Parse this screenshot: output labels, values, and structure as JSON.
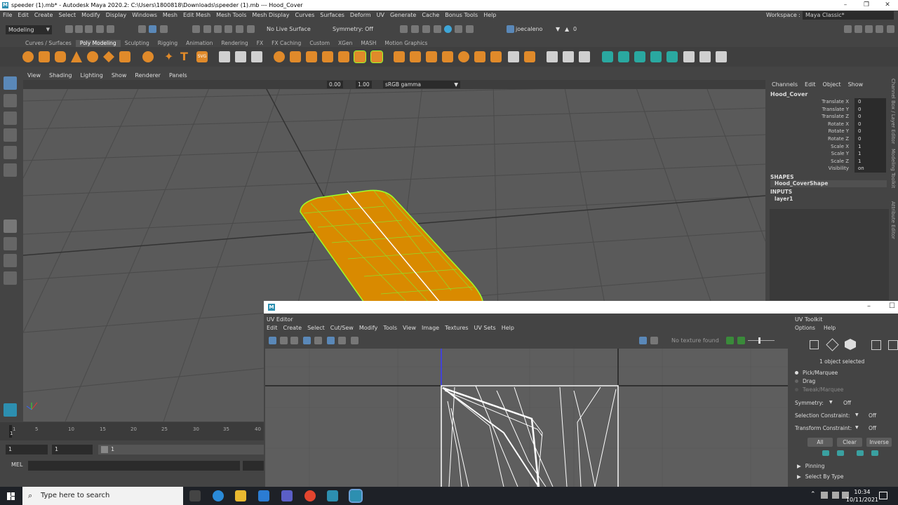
{
  "title_bar": {
    "app_icon": "M",
    "text": "speeder (1).mb* - Autodesk Maya 2020.2: C:\\Users\\1800818\\Downloads\\speeder (1).mb   ---   Hood_Cover"
  },
  "main_menu": [
    "File",
    "Edit",
    "Create",
    "Select",
    "Modify",
    "Display",
    "Windows",
    "Mesh",
    "Edit Mesh",
    "Mesh Tools",
    "Mesh Display",
    "Curves",
    "Surfaces",
    "Deform",
    "UV",
    "Generate",
    "Cache",
    "Bonus Tools",
    "Help"
  ],
  "workspace": {
    "label": "Workspace :",
    "value": "Maya Classic*"
  },
  "status_line": {
    "menu_set": "Modeling",
    "live_surface": "No Live Surface",
    "symmetry": "Symmetry: Off",
    "user": "joecaleno",
    "notifications": "0"
  },
  "shelf_tabs": [
    "Curves / Surfaces",
    "Poly Modeling",
    "Sculpting",
    "Rigging",
    "Animation",
    "Rendering",
    "FX",
    "FX Caching",
    "Custom",
    "XGen",
    "MASH",
    "Motion Graphics"
  ],
  "shelf_active_tab": "Poly Modeling",
  "viewport": {
    "menu": [
      "View",
      "Shading",
      "Lighting",
      "Show",
      "Renderer",
      "Panels"
    ],
    "exposure": "0.00",
    "gamma": "1.00",
    "color_space": "sRGB gamma",
    "object_color": "#d98a00",
    "wire_color": "#9dff2a"
  },
  "channel_box": {
    "menu": [
      "Channels",
      "Edit",
      "Object",
      "Show"
    ],
    "object_name": "Hood_Cover",
    "attributes": [
      {
        "name": "Translate X",
        "value": "0"
      },
      {
        "name": "Translate Y",
        "value": "0"
      },
      {
        "name": "Translate Z",
        "value": "0"
      },
      {
        "name": "Rotate X",
        "value": "0"
      },
      {
        "name": "Rotate Y",
        "value": "0"
      },
      {
        "name": "Rotate Z",
        "value": "0"
      },
      {
        "name": "Scale X",
        "value": "1"
      },
      {
        "name": "Scale Y",
        "value": "1"
      },
      {
        "name": "Scale Z",
        "value": "1"
      },
      {
        "name": "Visibility",
        "value": "on"
      }
    ],
    "shapes_label": "SHAPES",
    "shape_name": "Hood_CoverShape",
    "inputs_label": "INPUTS",
    "input_name": "layer1",
    "side_tabs": [
      "Channel Box / Layer Editor",
      "Modeling Toolkit",
      "Attribute Editor"
    ]
  },
  "timeline": {
    "ticks": [
      "1",
      "5",
      "10",
      "15",
      "20",
      "25",
      "30",
      "35",
      "40"
    ],
    "range_start": "1",
    "range_start2": "1",
    "range_field": "1",
    "mel_label": "MEL"
  },
  "uv_editor": {
    "window_icon": "M",
    "header": "UV Editor",
    "menu": [
      "Edit",
      "Create",
      "Select",
      "Cut/Sew",
      "Modify",
      "Tools",
      "View",
      "Image",
      "Textures",
      "UV Sets",
      "Help"
    ],
    "no_texture": "No texture found"
  },
  "uv_toolkit": {
    "title": "UV Toolkit",
    "menu": [
      "Options",
      "Help"
    ],
    "selected_count": "1 object selected",
    "modes": [
      "Pick/Marquee",
      "Drag",
      "Tweak/Marquee"
    ],
    "symmetry_label": "Symmetry:",
    "symmetry_value": "Off",
    "selection_constraint_label": "Selection Constraint:",
    "selection_constraint_value": "Off",
    "transform_constraint_label": "Transform Constraint:",
    "transform_constraint_value": "Off",
    "buttons": [
      "All",
      "Clear",
      "Inverse"
    ],
    "sections": [
      "Pinning",
      "Select By Type"
    ]
  },
  "taskbar": {
    "search_placeholder": "Type here to search",
    "time": "10:34",
    "date": "10/11/2021"
  }
}
